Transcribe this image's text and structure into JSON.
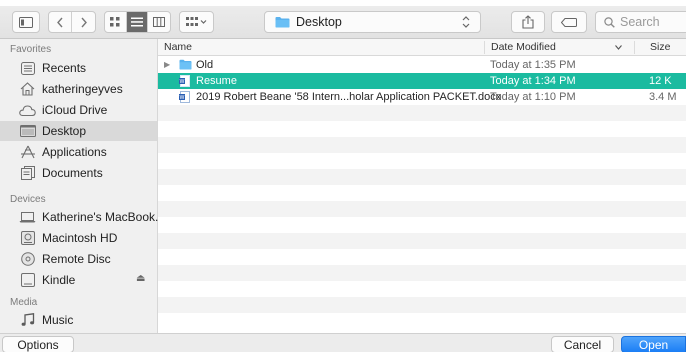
{
  "toolbar": {
    "location": "Desktop",
    "search_placeholder": "Search"
  },
  "sidebar": {
    "sections": {
      "favorites": "Favorites",
      "devices": "Devices",
      "media": "Media"
    },
    "favorites": [
      {
        "label": "Recents",
        "icon": "recents-icon"
      },
      {
        "label": "katheringeyves",
        "icon": "home-icon"
      },
      {
        "label": "iCloud Drive",
        "icon": "cloud-icon"
      },
      {
        "label": "Desktop",
        "icon": "desktop-icon",
        "selected": true
      },
      {
        "label": "Applications",
        "icon": "applications-icon"
      },
      {
        "label": "Documents",
        "icon": "documents-icon"
      }
    ],
    "devices": [
      {
        "label": "Katherine's MacBook...",
        "icon": "laptop-icon"
      },
      {
        "label": "Macintosh HD",
        "icon": "hard-drive-icon"
      },
      {
        "label": "Remote Disc",
        "icon": "disc-icon"
      },
      {
        "label": "Kindle",
        "icon": "drive-icon",
        "eject": "⏏"
      }
    ],
    "media": [
      {
        "label": "Music",
        "icon": "music-icon"
      }
    ]
  },
  "filelist": {
    "columns": {
      "name": "Name",
      "date": "Date Modified",
      "size": "Size"
    },
    "rows": [
      {
        "name": "Old",
        "date": "Today at 1:35 PM",
        "size": "",
        "type": "folder"
      },
      {
        "name": "Resume",
        "date": "Today at 1:34 PM",
        "size": "12 K",
        "type": "document",
        "selected": true
      },
      {
        "name": "2019 Robert Beane '58 Intern...holar Application PACKET.docx",
        "date": "Today at 1:10 PM",
        "size": "3.4 M",
        "type": "document"
      }
    ]
  },
  "buttons": {
    "options": "Options",
    "cancel": "Cancel",
    "open": "Open"
  },
  "colors": {
    "selection": "#1bbba0",
    "open_button": "#1b7ef5"
  }
}
